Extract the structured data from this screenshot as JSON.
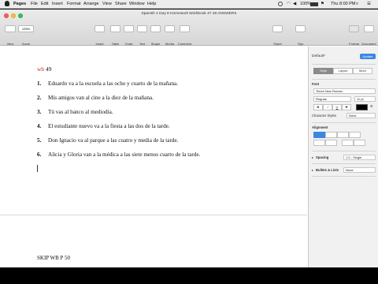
{
  "menubar": {
    "app": "Pages",
    "items": [
      "File",
      "Edit",
      "Insert",
      "Format",
      "Arrange",
      "View",
      "Share",
      "Window",
      "Help"
    ],
    "battery": "100%",
    "clock": "Thu 8:00 PM"
  },
  "window": {
    "title": "Spanish 1 Day 8 Homework Workbook 47 48 ANSWERS",
    "toolbar": {
      "view": "View",
      "zoom": "Zoom",
      "zoom_value": "125%",
      "insert": "Insert",
      "table": "Table",
      "chart": "Chart",
      "text": "Text",
      "shape": "Shape",
      "media": "Media",
      "comment": "Comment",
      "share": "Share",
      "tips": "Tips",
      "format": "Format",
      "document": "Document"
    }
  },
  "document": {
    "heading_prefix": "wb",
    "heading_number": "49",
    "lines": [
      {
        "n": "1.",
        "text": "Eduardo va a la escuela a las ocho y cuarto de la mañana."
      },
      {
        "n": "2.",
        "text": "Mis amigos van al cine a la diez de la mañana."
      },
      {
        "n": "3.",
        "text": "Tú vas al banco al mediodía."
      },
      {
        "n": "4.",
        "text": "El estudiante nuevo va a la fiesta a las dos de la tarde."
      },
      {
        "n": "5.",
        "text": "Don Ignacio va al parque a las cuatro y media de la tarde."
      },
      {
        "n": "6.",
        "text": "Alicia y Gloria van a la médica a las siete menos cuarto de la tarde."
      }
    ],
    "footer_note": "SKIP WB P 50"
  },
  "panel": {
    "style_name": "Default*",
    "update": "Update",
    "tabs": [
      "Style",
      "Layout",
      "More"
    ],
    "font_header": "Font",
    "font_family": "Times New Roman",
    "font_weight": "Regular",
    "font_size": "11 pt",
    "bold": "B",
    "italic": "I",
    "underline": "U",
    "strike": "S",
    "char_styles_label": "Character Styles",
    "char_styles_value": "None",
    "alignment_header": "Alignment",
    "spacing_label": "Spacing",
    "spacing_value": "1.0 - Single",
    "bullets_label": "Bullets & Lists",
    "bullets_value": "None",
    "text_color": "#000000",
    "accent": "#3b87e0"
  }
}
